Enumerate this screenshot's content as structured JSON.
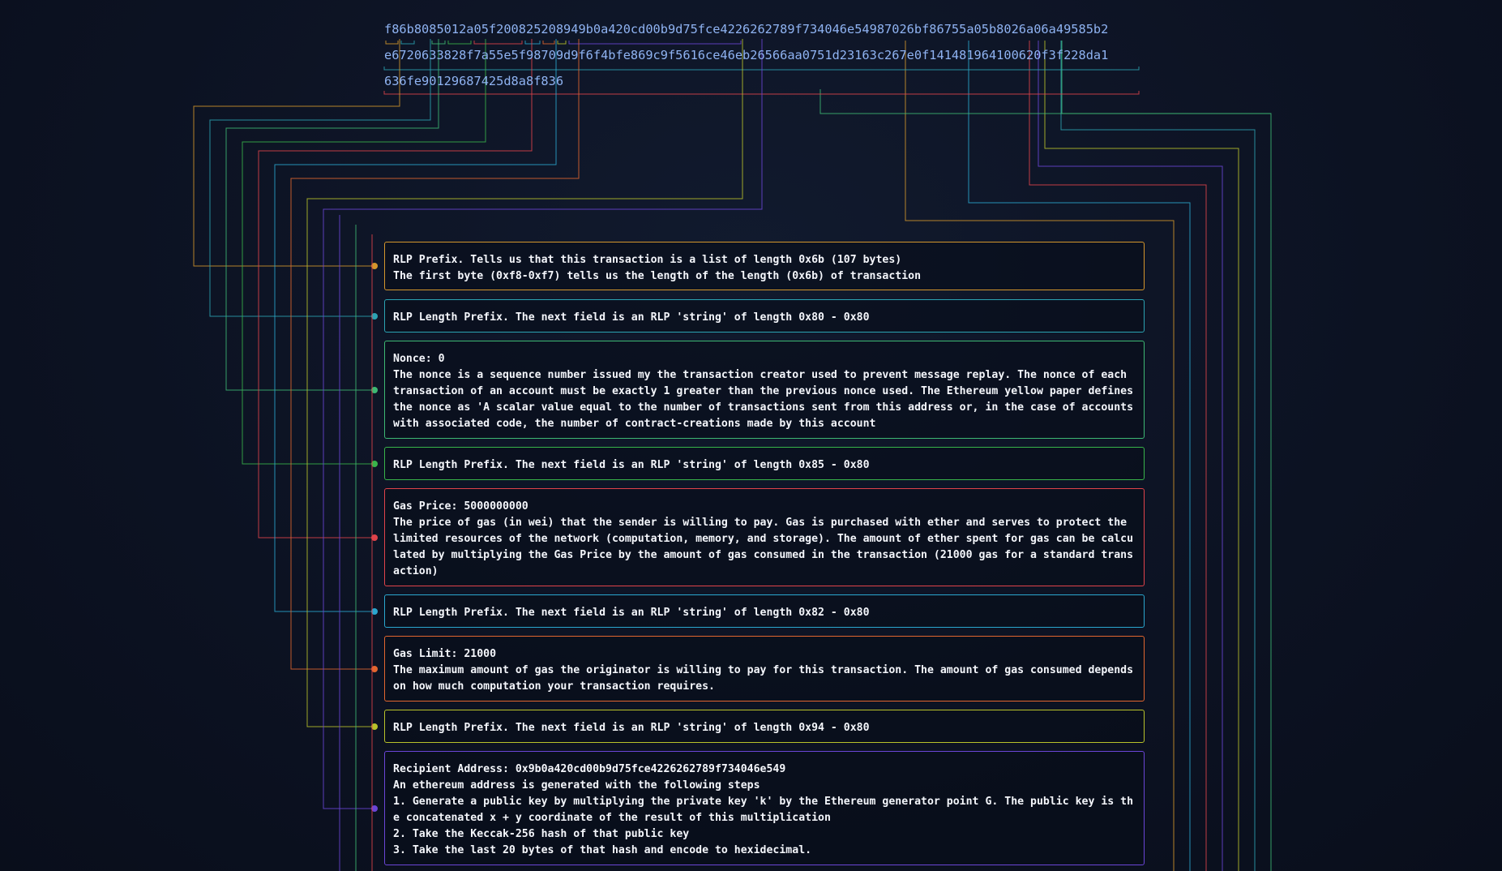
{
  "hex_lines": [
    "f86b8085012a05f200825208949b0a420cd00b9d75fce4226262789f734046e54987026bf86755a05b8026a06a49585b2",
    "e6720633828f7a55e5f98709d9f6f4bfe869c9f5616ce46eb26566aa0751d23163c267e0f141481964100620f3f228da1",
    "636fe90129687425d8a8f836"
  ],
  "fields": [
    {
      "color": "#d4962c",
      "lines": [
        "RLP Prefix. Tells us that this transaction is a list of length 0x6b (107 bytes)",
        "The first byte (0xf8-0xf7) tells us the length of the length (0x6b) of transaction"
      ]
    },
    {
      "color": "#2ba3b3",
      "lines": [
        "RLP Length Prefix. The next field is an RLP 'string' of length 0x80 - 0x80"
      ]
    },
    {
      "color": "#3db873",
      "lines": [
        "Nonce: 0",
        "The nonce is a sequence number issued my the transaction creator used to prevent message replay. The nonce of each transaction of an account must be exactly 1 greater than the previous nonce used. The Ethereum yellow paper defines the nonce as 'A scalar value equal to the number of transactions sent from this address or, in the case of accounts with associated code, the number of contract-creations made by this account"
      ]
    },
    {
      "color": "#38b44a",
      "lines": [
        "RLP Length Prefix. The next field is an RLP 'string' of length 0x85 - 0x80"
      ]
    },
    {
      "color": "#e0434a",
      "lines": [
        "Gas Price: 5000000000",
        "The price of gas (in wei) that the sender is willing to pay. Gas is purchased with ether and serves to protect the limited resources of the network (computation, memory, and storage). The amount of ether spent for gas can be calculated by multiplying the Gas Price by the amount of gas consumed in the transaction (21000 gas for a standard transaction)"
      ]
    },
    {
      "color": "#2aa7cf",
      "lines": [
        "RLP Length Prefix. The next field is an RLP 'string' of length 0x82 - 0x80"
      ]
    },
    {
      "color": "#e2662f",
      "lines": [
        "Gas Limit: 21000",
        "The maximum amount of gas the originator is willing to pay for this transaction. The amount of gas consumed depends on how much computation your transaction requires."
      ]
    },
    {
      "color": "#b8c22a",
      "lines": [
        "RLP Length Prefix. The next field is an RLP 'string' of length 0x94 - 0x80"
      ]
    },
    {
      "color": "#6a45d6",
      "lines": [
        "Recipient Address: 0x9b0a420cd00b9d75fce4226262789f734046e549",
        "An ethereum address is generated with the following steps",
        "1. Generate a public key by multiplying the private key 'k' by the Ethereum generator point G. The public key is the concatenated x + y coordinate of the result of this multiplication",
        "2. Take the Keccak-256 hash of that public key",
        "3. Take the last 20 bytes of that hash and encode to hexidecimal."
      ]
    }
  ]
}
